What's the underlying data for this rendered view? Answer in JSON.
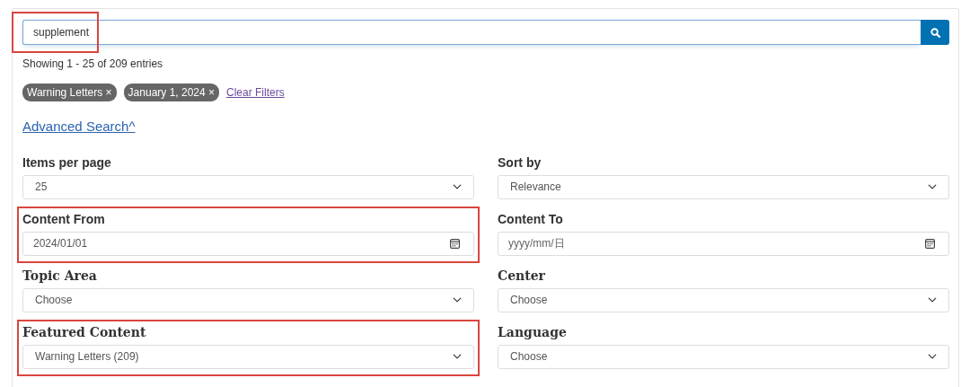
{
  "search": {
    "value": "supplement",
    "highlighted": true
  },
  "results_summary": "Showing 1 - 25 of 209 entries",
  "active_filters": [
    {
      "label": "Warning Letters ×"
    },
    {
      "label": "January 1, 2024 ×"
    }
  ],
  "clear_filters": "Clear Filters",
  "advanced_search": {
    "label": "Advanced Search^"
  },
  "options": [
    {
      "kind": "select",
      "label": "Items per page",
      "value": "25",
      "highlighted": false
    },
    {
      "kind": "select",
      "label": "Sort by",
      "value": "Relevance",
      "highlighted": false
    },
    {
      "kind": "date",
      "label": "Content From",
      "value": "2024/01/01",
      "highlighted": true
    },
    {
      "kind": "date",
      "label": "Content To",
      "placeholder": "yyyy/mm/日",
      "highlighted": false
    }
  ],
  "facets": [
    {
      "kind": "select",
      "label": "Topic Area",
      "value": "Choose",
      "highlighted": false
    },
    {
      "kind": "select",
      "label": "Center",
      "value": "Choose",
      "highlighted": false
    },
    {
      "kind": "select",
      "label": "Featured Content",
      "value": "Warning Letters (209)",
      "highlighted": true
    },
    {
      "kind": "select",
      "label": "Language",
      "value": "Choose",
      "highlighted": false
    }
  ]
}
